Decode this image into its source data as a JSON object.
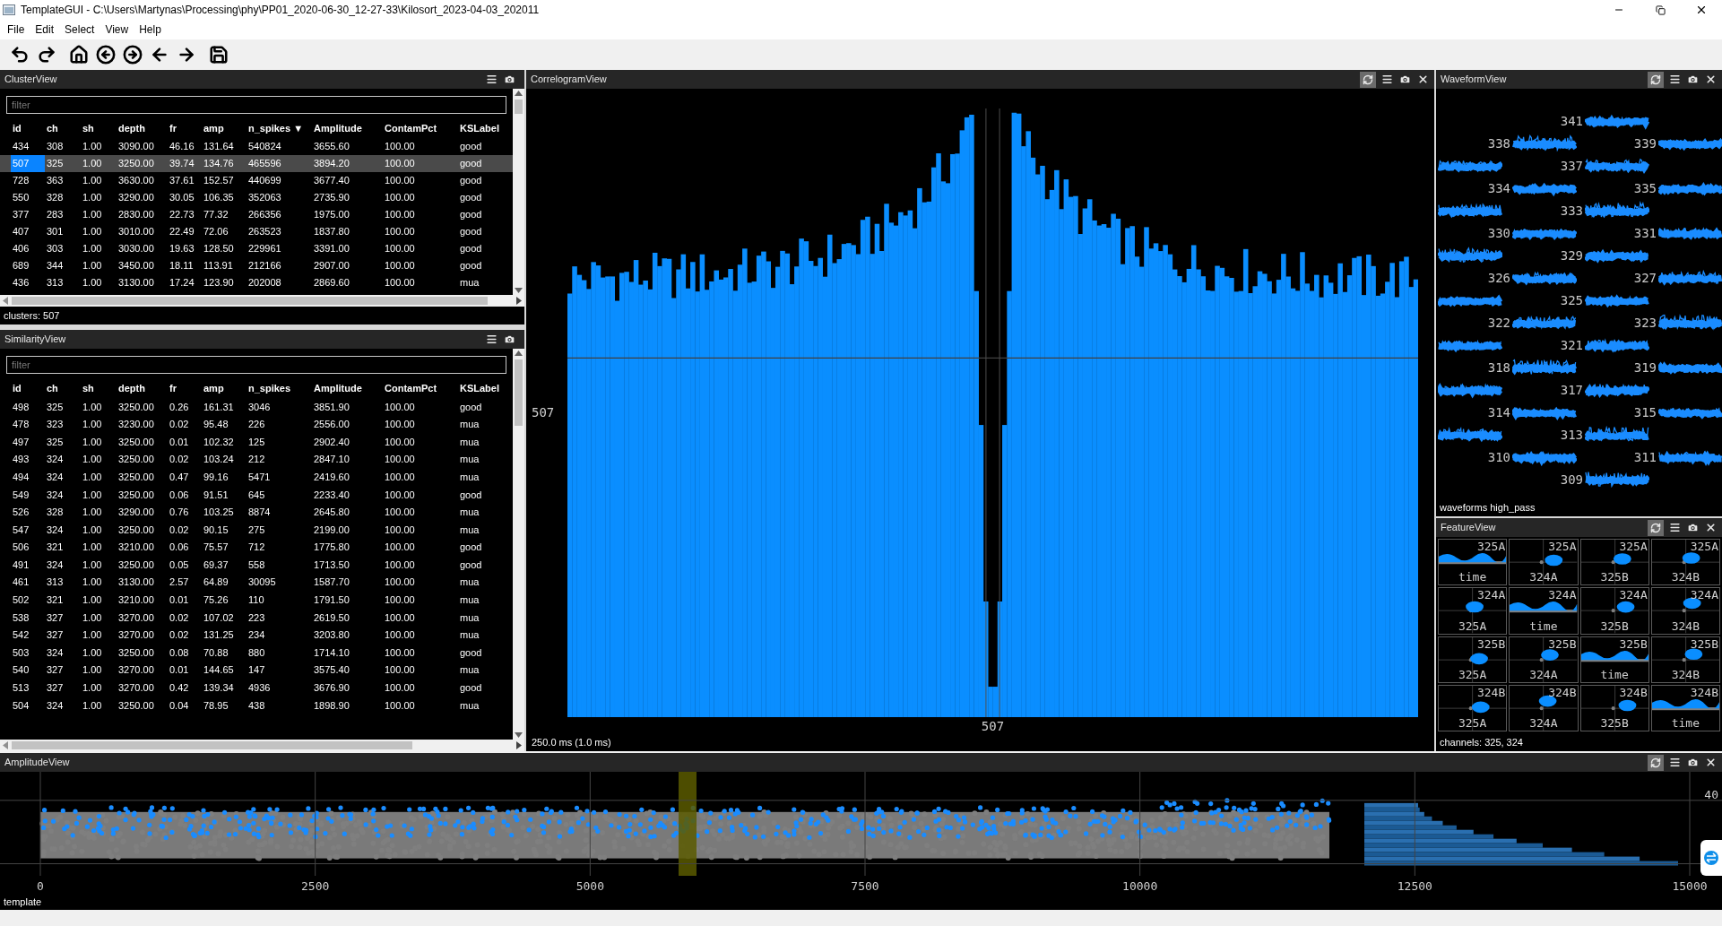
{
  "window": {
    "title": "TemplateGUI - C:\\Users\\Martynas\\Processing\\phy\\PP01_2020-06-30_12-27-33\\Kilosort_2023-04-03_202011"
  },
  "menu": [
    "File",
    "Edit",
    "Select",
    "View",
    "Help"
  ],
  "cluster_view": {
    "title": "ClusterView",
    "filter": {
      "placeholder": "filter"
    },
    "columns": [
      "id",
      "ch",
      "sh",
      "depth",
      "fr",
      "amp",
      "n_spikes ▼",
      "Amplitude",
      "ContamPct",
      "KSLabel"
    ],
    "rows": [
      {
        "cells": [
          "434",
          "308",
          "1.00",
          "3090.00",
          "46.16",
          "131.64",
          "540824",
          "3655.60",
          "100.00",
          "good"
        ],
        "selected": false
      },
      {
        "cells": [
          "507",
          "325",
          "1.00",
          "3250.00",
          "39.74",
          "134.76",
          "465596",
          "3894.20",
          "100.00",
          "good"
        ],
        "selected": true
      },
      {
        "cells": [
          "728",
          "363",
          "1.00",
          "3630.00",
          "37.61",
          "152.57",
          "440699",
          "3677.40",
          "100.00",
          "good"
        ],
        "selected": false
      },
      {
        "cells": [
          "550",
          "328",
          "1.00",
          "3290.00",
          "30.05",
          "106.35",
          "352063",
          "2735.90",
          "100.00",
          "good"
        ],
        "selected": false
      },
      {
        "cells": [
          "377",
          "283",
          "1.00",
          "2830.00",
          "22.73",
          "77.32",
          "266356",
          "1975.00",
          "100.00",
          "good"
        ],
        "selected": false
      },
      {
        "cells": [
          "407",
          "301",
          "1.00",
          "3010.00",
          "22.49",
          "72.06",
          "263523",
          "1837.80",
          "100.00",
          "good"
        ],
        "selected": false
      },
      {
        "cells": [
          "406",
          "303",
          "1.00",
          "3030.00",
          "19.63",
          "128.50",
          "229961",
          "3391.00",
          "100.00",
          "good"
        ],
        "selected": false
      },
      {
        "cells": [
          "689",
          "344",
          "1.00",
          "3450.00",
          "18.11",
          "113.91",
          "212166",
          "2907.00",
          "100.00",
          "good"
        ],
        "selected": false
      },
      {
        "cells": [
          "436",
          "313",
          "1.00",
          "3130.00",
          "17.24",
          "123.90",
          "202008",
          "2869.60",
          "100.00",
          "mua"
        ],
        "selected": false
      }
    ],
    "status": "clusters: 507"
  },
  "similarity_view": {
    "title": "SimilarityView",
    "filter": {
      "placeholder": "filter"
    },
    "columns": [
      "id",
      "ch",
      "sh",
      "depth",
      "fr",
      "amp",
      "n_spikes",
      "Amplitude",
      "ContamPct",
      "KSLabel"
    ],
    "rows": [
      {
        "cells": [
          "498",
          "325",
          "1.00",
          "3250.00",
          "0.26",
          "161.31",
          "3046",
          "3851.90",
          "100.00",
          "good"
        ],
        "selected": false
      },
      {
        "cells": [
          "478",
          "323",
          "1.00",
          "3230.00",
          "0.02",
          "95.48",
          "226",
          "2556.00",
          "100.00",
          "mua"
        ],
        "selected": false
      },
      {
        "cells": [
          "497",
          "325",
          "1.00",
          "3250.00",
          "0.01",
          "102.32",
          "125",
          "2902.40",
          "100.00",
          "mua"
        ],
        "selected": false
      },
      {
        "cells": [
          "493",
          "324",
          "1.00",
          "3250.00",
          "0.02",
          "103.24",
          "212",
          "2847.10",
          "100.00",
          "mua"
        ],
        "selected": false
      },
      {
        "cells": [
          "494",
          "324",
          "1.00",
          "3250.00",
          "0.47",
          "99.16",
          "5471",
          "2419.60",
          "100.00",
          "mua"
        ],
        "selected": false
      },
      {
        "cells": [
          "549",
          "324",
          "1.00",
          "3250.00",
          "0.06",
          "91.51",
          "645",
          "2233.40",
          "100.00",
          "good"
        ],
        "selected": false
      },
      {
        "cells": [
          "526",
          "328",
          "1.00",
          "3290.00",
          "0.76",
          "103.25",
          "8874",
          "2645.80",
          "100.00",
          "mua"
        ],
        "selected": false
      },
      {
        "cells": [
          "547",
          "324",
          "1.00",
          "3250.00",
          "0.02",
          "90.15",
          "275",
          "2199.00",
          "100.00",
          "mua"
        ],
        "selected": false
      },
      {
        "cells": [
          "506",
          "321",
          "1.00",
          "3210.00",
          "0.06",
          "75.57",
          "712",
          "1775.80",
          "100.00",
          "good"
        ],
        "selected": false
      },
      {
        "cells": [
          "491",
          "324",
          "1.00",
          "3250.00",
          "0.05",
          "69.37",
          "558",
          "1713.50",
          "100.00",
          "good"
        ],
        "selected": false
      },
      {
        "cells": [
          "461",
          "313",
          "1.00",
          "3130.00",
          "2.57",
          "64.89",
          "30095",
          "1587.70",
          "100.00",
          "mua"
        ],
        "selected": false
      },
      {
        "cells": [
          "502",
          "321",
          "1.00",
          "3210.00",
          "0.01",
          "75.26",
          "110",
          "1791.50",
          "100.00",
          "mua"
        ],
        "selected": false
      },
      {
        "cells": [
          "538",
          "327",
          "1.00",
          "3270.00",
          "0.02",
          "107.02",
          "223",
          "2619.50",
          "100.00",
          "mua"
        ],
        "selected": false
      },
      {
        "cells": [
          "542",
          "327",
          "1.00",
          "3270.00",
          "0.02",
          "131.25",
          "234",
          "3203.80",
          "100.00",
          "mua"
        ],
        "selected": false
      },
      {
        "cells": [
          "503",
          "324",
          "1.00",
          "3250.00",
          "0.08",
          "70.88",
          "880",
          "1714.10",
          "100.00",
          "good"
        ],
        "selected": false
      },
      {
        "cells": [
          "540",
          "327",
          "1.00",
          "3270.00",
          "0.01",
          "144.65",
          "147",
          "3575.40",
          "100.00",
          "mua"
        ],
        "selected": false
      },
      {
        "cells": [
          "513",
          "327",
          "1.00",
          "3270.00",
          "0.42",
          "139.34",
          "4936",
          "3676.90",
          "100.00",
          "good"
        ],
        "selected": false
      },
      {
        "cells": [
          "504",
          "324",
          "1.00",
          "3250.00",
          "0.04",
          "78.95",
          "438",
          "1898.90",
          "100.00",
          "mua"
        ],
        "selected": false
      }
    ]
  },
  "correlogram_view": {
    "title": "CorrelogramView",
    "auto_update": true,
    "y_label": "507",
    "x_label": "507",
    "status": "250.0 ms (1.0 ms)"
  },
  "waveform_view": {
    "title": "WaveformView",
    "auto_update": true,
    "rows": [
      {
        "traces": [
          {
            "kind": "center",
            "label": "341"
          }
        ]
      },
      {
        "traces": [
          {
            "kind": "left",
            "label": "338"
          },
          {
            "kind": "right",
            "label": "339"
          }
        ]
      },
      {
        "traces": [
          {
            "kind": "edge"
          },
          {
            "kind": "center",
            "label": "337"
          }
        ]
      },
      {
        "traces": [
          {
            "kind": "left",
            "label": "334"
          },
          {
            "kind": "right",
            "label": "335"
          }
        ]
      },
      {
        "traces": [
          {
            "kind": "edge"
          },
          {
            "kind": "center",
            "label": "333"
          }
        ]
      },
      {
        "traces": [
          {
            "kind": "left",
            "label": "330"
          },
          {
            "kind": "right",
            "label": "331"
          }
        ]
      },
      {
        "traces": [
          {
            "kind": "edge"
          },
          {
            "kind": "center",
            "label": "329"
          }
        ]
      },
      {
        "traces": [
          {
            "kind": "left",
            "label": "326"
          },
          {
            "kind": "right",
            "label": "327"
          }
        ]
      },
      {
        "traces": [
          {
            "kind": "edge"
          },
          {
            "kind": "center",
            "label": "325"
          }
        ]
      },
      {
        "traces": [
          {
            "kind": "left",
            "label": "322"
          },
          {
            "kind": "right",
            "label": "323"
          }
        ]
      },
      {
        "traces": [
          {
            "kind": "edge"
          },
          {
            "kind": "center",
            "label": "321"
          }
        ]
      },
      {
        "traces": [
          {
            "kind": "left",
            "label": "318"
          },
          {
            "kind": "right",
            "label": "319"
          }
        ]
      },
      {
        "traces": [
          {
            "kind": "edge"
          },
          {
            "kind": "center",
            "label": "317"
          }
        ]
      },
      {
        "traces": [
          {
            "kind": "left",
            "label": "314"
          },
          {
            "kind": "right",
            "label": "315"
          }
        ]
      },
      {
        "traces": [
          {
            "kind": "edge"
          },
          {
            "kind": "center",
            "label": "313"
          }
        ]
      },
      {
        "traces": [
          {
            "kind": "left",
            "label": "310"
          },
          {
            "kind": "right",
            "label": "311"
          }
        ]
      },
      {
        "traces": [
          {
            "kind": "center",
            "label": "309"
          }
        ]
      }
    ],
    "status": "waveforms high_pass"
  },
  "feature_view": {
    "title": "FeatureView",
    "auto_update": true,
    "grid": [
      [
        {
          "top": "325A",
          "bottom": "time"
        },
        {
          "top": "325A",
          "bottom": "324A"
        },
        {
          "top": "325A",
          "bottom": "325B"
        },
        {
          "top": "325A",
          "bottom": "324B"
        }
      ],
      [
        {
          "top": "324A",
          "bottom": "325A"
        },
        {
          "top": "324A",
          "bottom": "time"
        },
        {
          "top": "324A",
          "bottom": "325B"
        },
        {
          "top": "324A",
          "bottom": "324B"
        }
      ],
      [
        {
          "top": "325B",
          "bottom": "325A"
        },
        {
          "top": "325B",
          "bottom": "324A"
        },
        {
          "top": "325B",
          "bottom": "time"
        },
        {
          "top": "325B",
          "bottom": "324B"
        }
      ],
      [
        {
          "top": "324B",
          "bottom": "325A"
        },
        {
          "top": "324B",
          "bottom": "324A"
        },
        {
          "top": "324B",
          "bottom": "325B"
        },
        {
          "top": "324B",
          "bottom": "time"
        }
      ]
    ],
    "status": "channels: 325, 324"
  },
  "amplitude_view": {
    "title": "AmplitudeView",
    "auto_update": true,
    "x_ticks": [
      "0",
      "2500",
      "5000",
      "7500",
      "10000",
      "12500",
      "15000"
    ],
    "y_tick": "40",
    "status": "template"
  }
}
